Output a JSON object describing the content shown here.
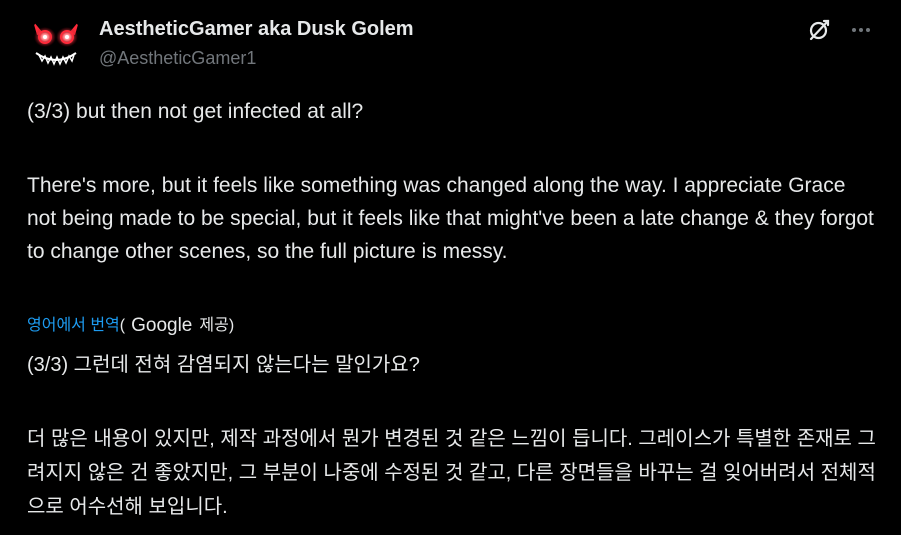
{
  "author": {
    "display_name": "AestheticGamer aka Dusk Golem",
    "handle": "@AestheticGamer1",
    "avatar_icon": "glowing-eyes-face-avatar"
  },
  "actions": {
    "grok_icon": "grok-icon",
    "more_icon": "more-options-icon"
  },
  "tweet": {
    "paragraph_1": "(3/3) but then not get infected at all?",
    "paragraph_2": "There's more, but it feels like something was changed along the way. I appreciate Grace not being made to be special, but it feels like that might've been a late change & they forgot to change other scenes, so the full picture is messy."
  },
  "translation": {
    "link_label": "영어에서 번역",
    "open_paren": "(",
    "provider": "Google",
    "provided_label": "제공)",
    "paragraph_1": "(3/3) 그런데 전혀 감염되지 않는다는 말인가요?",
    "paragraph_2": "더 많은 내용이 있지만, 제작 과정에서 뭔가 변경된 것 같은 느낌이 듭니다. 그레이스가 특별한 존재로 그려지지 않은 건 좋았지만, 그 부분이 나중에 수정된 것 같고, 다른 장면들을 바꾸는 걸 잊어버려서 전체적으로 어수선해 보입니다."
  },
  "colors": {
    "background": "#000000",
    "text_primary": "#e7e9ea",
    "text_secondary": "#71767b",
    "link": "#1d9bf0",
    "avatar_eye_red": "#ff2a3a"
  }
}
